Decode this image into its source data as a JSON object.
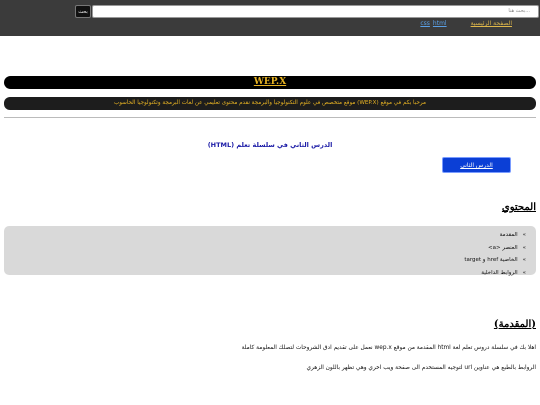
{
  "header": {
    "search_button_label": "بحث",
    "search_placeholder": "بحث هنا...",
    "nav": {
      "home_label": "الصفحة الرئيسية",
      "html_label": "html",
      "css_label": "css"
    }
  },
  "brand": {
    "title": "WEP.X"
  },
  "welcome_text": "مرحبا بكم في موقع (WEP.X) موقع متخصص في علوم التكنولوجيا والبرمجة نقدم محتوى تعليمي عن لغات البرمجة وتكنولوجيا الحاسوب",
  "lesson": {
    "title": "الدرس الثاني في سلسلة تعلم (HTML)",
    "next_button_label": "الدرس الثاني"
  },
  "content": {
    "heading": "المحتوي",
    "items": [
      "المقدمة",
      "العنصر <a>",
      "الخاصية href و target",
      "الروابط الداخلية"
    ],
    "bullet": "»"
  },
  "intro": {
    "heading": "(المقدمة)",
    "paragraph1": "اهلا بك في سلسلة دروس تعلم لغة html المقدمة من موقع wep.x نعمل على تقديم ادق الشروحات لتصلك المعلومة كاملة",
    "paragraph2": "الروابط بالطبع هي عناوين url لتوجيه المستخدم الى صفحة ويب اخري وهي تظهر باللون الزهري"
  }
}
